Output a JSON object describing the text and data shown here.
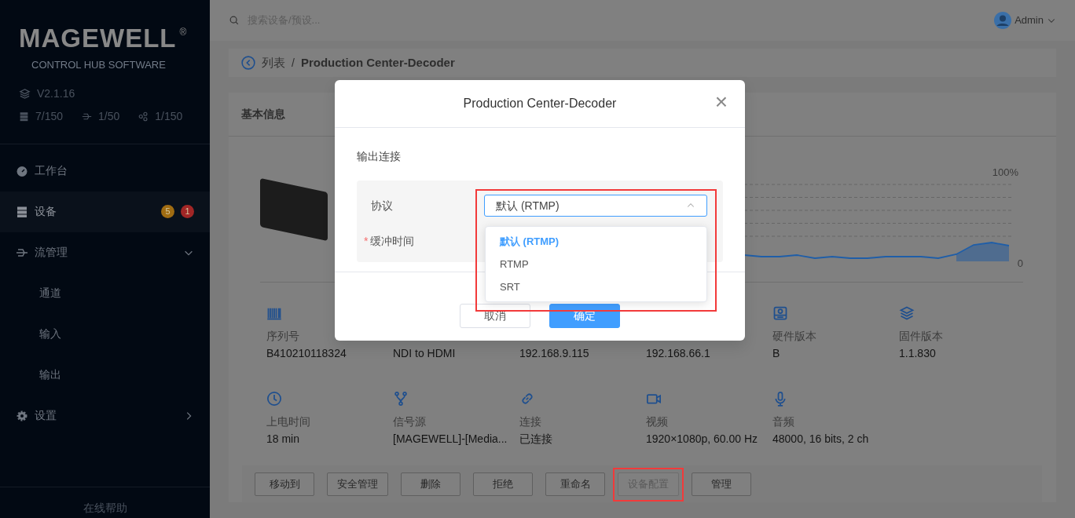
{
  "sidebar": {
    "logo": "MAGEWELL",
    "logo_mark": "®",
    "subtitle": "CONTROL HUB SOFTWARE",
    "version": "V2.1.16",
    "stats": [
      {
        "kind": "devices",
        "value": "7/150"
      },
      {
        "kind": "streams",
        "value": "1/50"
      },
      {
        "kind": "nodes",
        "value": "1/150"
      }
    ],
    "menu": [
      {
        "kind": "dashboard",
        "label": "工作台",
        "selected": false
      },
      {
        "kind": "devices",
        "label": "设备",
        "selected": true,
        "badges": [
          {
            "text": "5",
            "color": "#a06c12"
          },
          {
            "text": "1",
            "color": "#a12626"
          }
        ]
      },
      {
        "kind": "streams",
        "label": "流管理",
        "selected": false,
        "expanded": true,
        "children": [
          {
            "label": "通道",
            "selected": false
          },
          {
            "label": "输入",
            "selected": false
          },
          {
            "label": "输出",
            "selected": false
          }
        ]
      },
      {
        "kind": "settings",
        "label": "设置",
        "selected": false,
        "expanded": false
      }
    ],
    "help": "在线帮助"
  },
  "header": {
    "search": {
      "placeholder": "搜索设备/预设..."
    },
    "user": "Admin"
  },
  "breadcrumb": {
    "parent": "列表",
    "separator": "/",
    "current": "Production Center-Decoder"
  },
  "info_card": {
    "title": "基本信息",
    "chart": {
      "top_label": "100%",
      "bottom_label": "0"
    },
    "fields": [
      {
        "kind": "barcode",
        "label": "序列号",
        "value": "B410210118324"
      },
      {
        "value": "NDI to HDMI"
      },
      {
        "value": "192.168.9.115"
      },
      {
        "value": "192.168.66.1"
      },
      {
        "kind": "disk",
        "label": "硬件版本",
        "value": "B"
      },
      {
        "kind": "layers",
        "label": "固件版本",
        "value": "1.1.830"
      },
      {
        "kind": "clock",
        "label": "上电时间",
        "value": "18 min"
      },
      {
        "kind": "branch",
        "label": "信号源",
        "value": "[MAGEWELL]-[Media..."
      },
      {
        "kind": "link",
        "label": "连接",
        "value": "已连接"
      },
      {
        "kind": "camera",
        "label": "视频",
        "value": "1920×1080p, 60.00 Hz"
      },
      {
        "kind": "mic",
        "label": "音频",
        "value": "48000, 16 bits, 2 ch"
      }
    ]
  },
  "actions": [
    {
      "label": "移动到",
      "disabled": false,
      "highlighted": false
    },
    {
      "label": "安全管理",
      "disabled": false,
      "highlighted": false
    },
    {
      "label": "删除",
      "disabled": false,
      "highlighted": false
    },
    {
      "label": "拒绝",
      "disabled": false,
      "highlighted": false
    },
    {
      "label": "重命名",
      "disabled": false,
      "highlighted": false
    },
    {
      "label": "设备配置",
      "disabled": true,
      "highlighted": true
    },
    {
      "label": "管理",
      "disabled": false,
      "highlighted": false
    }
  ],
  "modal": {
    "title": "Production Center-Decoder",
    "close": "×",
    "section": "输出连接",
    "fields": [
      {
        "label": "协议",
        "value": "默认 (RTMP)",
        "open": true,
        "highlighted": true,
        "options": [
          {
            "label": "默认 (RTMP)",
            "selected": true
          },
          {
            "label": "RTMP",
            "selected": false
          },
          {
            "label": "SRT",
            "selected": false
          }
        ]
      },
      {
        "label": "缓冲时间",
        "required_mark": "*"
      }
    ],
    "buttons": [
      {
        "label": "取消",
        "kind": "secondary"
      },
      {
        "label": "确定",
        "kind": "primary"
      }
    ]
  }
}
